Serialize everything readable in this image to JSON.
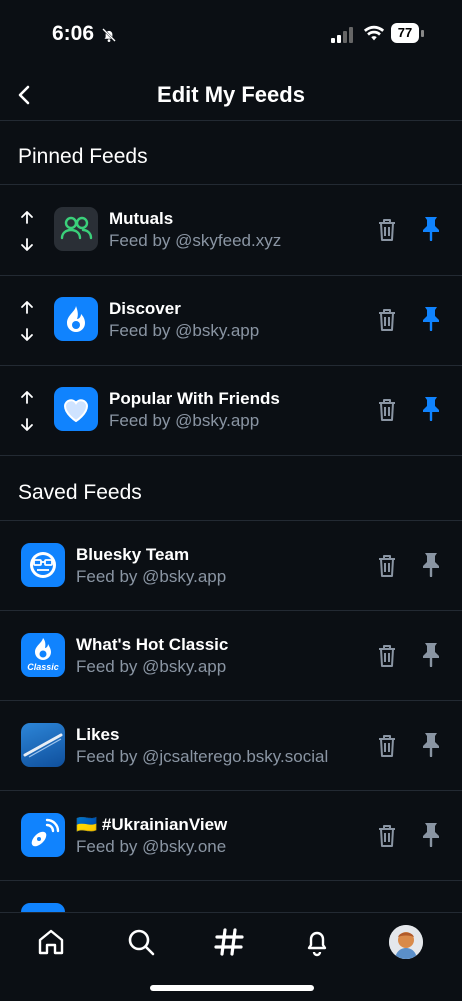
{
  "status": {
    "time": "6:06",
    "battery": "77"
  },
  "header": {
    "title": "Edit My Feeds"
  },
  "pinned": {
    "heading": "Pinned Feeds",
    "items": [
      {
        "name": "Mutuals",
        "by": "Feed by @skyfeed.xyz",
        "icon": "mutuals-icon"
      },
      {
        "name": "Discover",
        "by": "Feed by @bsky.app",
        "icon": "discover-icon"
      },
      {
        "name": "Popular With Friends",
        "by": "Feed by @bsky.app",
        "icon": "heart-icon"
      }
    ]
  },
  "saved": {
    "heading": "Saved Feeds",
    "items": [
      {
        "name": "Bluesky Team",
        "by": "Feed by @bsky.app",
        "icon": "bluesky-team-icon"
      },
      {
        "name": "What's Hot Classic",
        "by": "Feed by @bsky.app",
        "icon": "classic-icon",
        "badge": "Classic"
      },
      {
        "name": "Likes",
        "by": "Feed by @jcsalterego.bsky.social",
        "icon": "likes-icon"
      },
      {
        "name": "🇺🇦 #UkrainianView",
        "by": "Feed by @bsky.one",
        "icon": "satellite-icon"
      }
    ]
  },
  "colors": {
    "accent": "#1083fe",
    "muted": "#8a95a3",
    "background": "#0b0f14"
  }
}
